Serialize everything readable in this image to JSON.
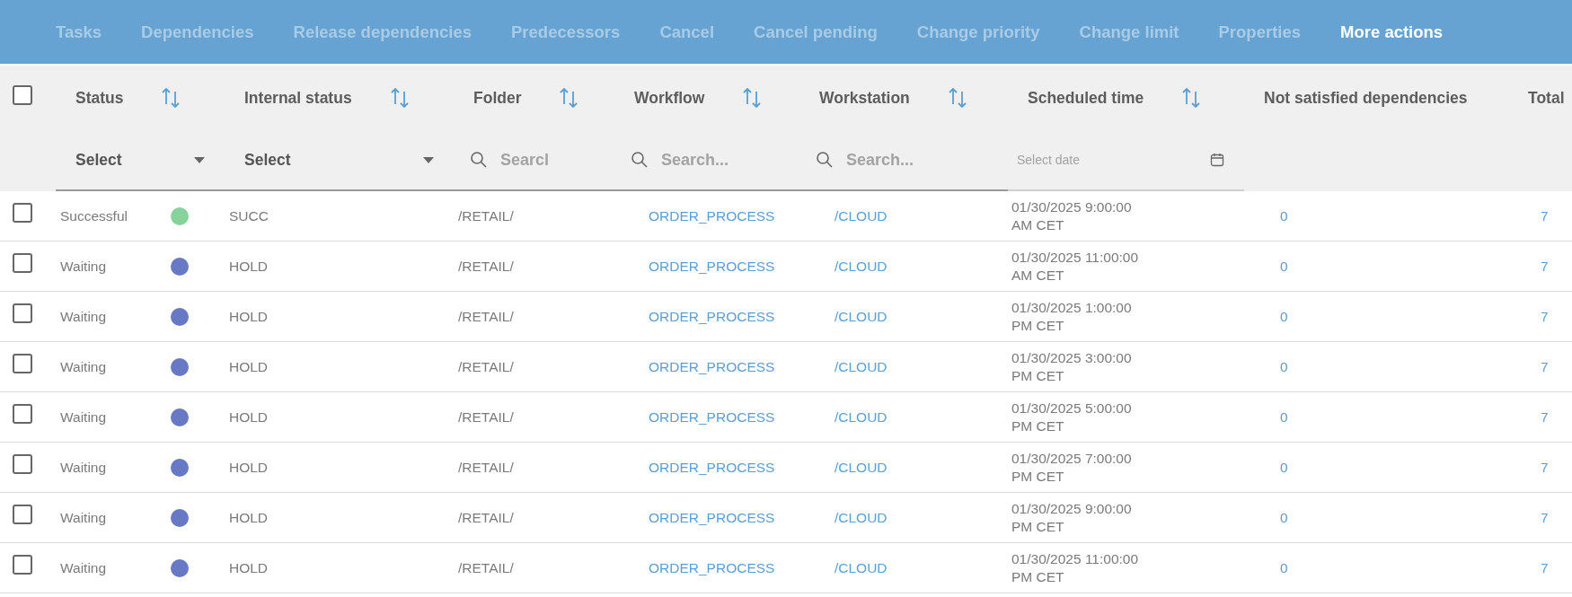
{
  "toolbar": {
    "actions": [
      {
        "label": "Tasks",
        "disabled": true
      },
      {
        "label": "Dependencies",
        "disabled": true
      },
      {
        "label": "Release dependencies",
        "disabled": true
      },
      {
        "label": "Predecessors",
        "disabled": true
      },
      {
        "label": "Cancel",
        "disabled": true
      },
      {
        "label": "Cancel pending",
        "disabled": true
      },
      {
        "label": "Change priority",
        "disabled": true
      },
      {
        "label": "Change limit",
        "disabled": true
      },
      {
        "label": "Properties",
        "disabled": true
      },
      {
        "label": "More actions",
        "disabled": false
      }
    ]
  },
  "table": {
    "select_all": {
      "checked": false
    },
    "columns": [
      {
        "label": "Status",
        "sortable": true
      },
      {
        "label": "Internal status",
        "sortable": true
      },
      {
        "label": "Folder",
        "sortable": true
      },
      {
        "label": "Workflow",
        "sortable": true
      },
      {
        "label": "Workstation",
        "sortable": true
      },
      {
        "label": "Scheduled time",
        "sortable": true
      },
      {
        "label": "Not satisfied dependencies",
        "sortable": false
      },
      {
        "label": "Total",
        "sortable": false
      }
    ],
    "filters": [
      {
        "kind": "select",
        "value": "Select"
      },
      {
        "kind": "select",
        "value": "Select"
      },
      {
        "kind": "search",
        "placeholder": "Searcl"
      },
      {
        "kind": "search",
        "placeholder": "Search..."
      },
      {
        "kind": "search",
        "placeholder": "Search..."
      },
      {
        "kind": "date",
        "placeholder": "Select date"
      }
    ],
    "rows": [
      {
        "selected": false,
        "status": "Successful",
        "color": "#86d49c",
        "internal_status": "SUCC",
        "folder": "/RETAIL/",
        "workflow": "ORDER_PROCESS",
        "workstation": "/CLOUD",
        "scheduled_time": "01/30/2025 9:00:00 AM CET",
        "not_satisfied": "0",
        "total": "7"
      },
      {
        "selected": false,
        "status": "Waiting",
        "color": "#6778c4",
        "internal_status": "HOLD",
        "folder": "/RETAIL/",
        "workflow": "ORDER_PROCESS",
        "workstation": "/CLOUD",
        "scheduled_time": "01/30/2025 11:00:00 AM CET",
        "not_satisfied": "0",
        "total": "7"
      },
      {
        "selected": false,
        "status": "Waiting",
        "color": "#6778c4",
        "internal_status": "HOLD",
        "folder": "/RETAIL/",
        "workflow": "ORDER_PROCESS",
        "workstation": "/CLOUD",
        "scheduled_time": "01/30/2025 1:00:00 PM CET",
        "not_satisfied": "0",
        "total": "7"
      },
      {
        "selected": false,
        "status": "Waiting",
        "color": "#6778c4",
        "internal_status": "HOLD",
        "folder": "/RETAIL/",
        "workflow": "ORDER_PROCESS",
        "workstation": "/CLOUD",
        "scheduled_time": "01/30/2025 3:00:00 PM CET",
        "not_satisfied": "0",
        "total": "7"
      },
      {
        "selected": false,
        "status": "Waiting",
        "color": "#6778c4",
        "internal_status": "HOLD",
        "folder": "/RETAIL/",
        "workflow": "ORDER_PROCESS",
        "workstation": "/CLOUD",
        "scheduled_time": "01/30/2025 5:00:00 PM CET",
        "not_satisfied": "0",
        "total": "7"
      },
      {
        "selected": false,
        "status": "Waiting",
        "color": "#6778c4",
        "internal_status": "HOLD",
        "folder": "/RETAIL/",
        "workflow": "ORDER_PROCESS",
        "workstation": "/CLOUD",
        "scheduled_time": "01/30/2025 7:00:00 PM CET",
        "not_satisfied": "0",
        "total": "7"
      },
      {
        "selected": false,
        "status": "Waiting",
        "color": "#6778c4",
        "internal_status": "HOLD",
        "folder": "/RETAIL/",
        "workflow": "ORDER_PROCESS",
        "workstation": "/CLOUD",
        "scheduled_time": "01/30/2025 9:00:00 PM CET",
        "not_satisfied": "0",
        "total": "7"
      },
      {
        "selected": false,
        "status": "Waiting",
        "color": "#6778c4",
        "internal_status": "HOLD",
        "folder": "/RETAIL/",
        "workflow": "ORDER_PROCESS",
        "workstation": "/CLOUD",
        "scheduled_time": "01/30/2025 11:00:00 PM CET",
        "not_satisfied": "0",
        "total": "7"
      }
    ]
  }
}
